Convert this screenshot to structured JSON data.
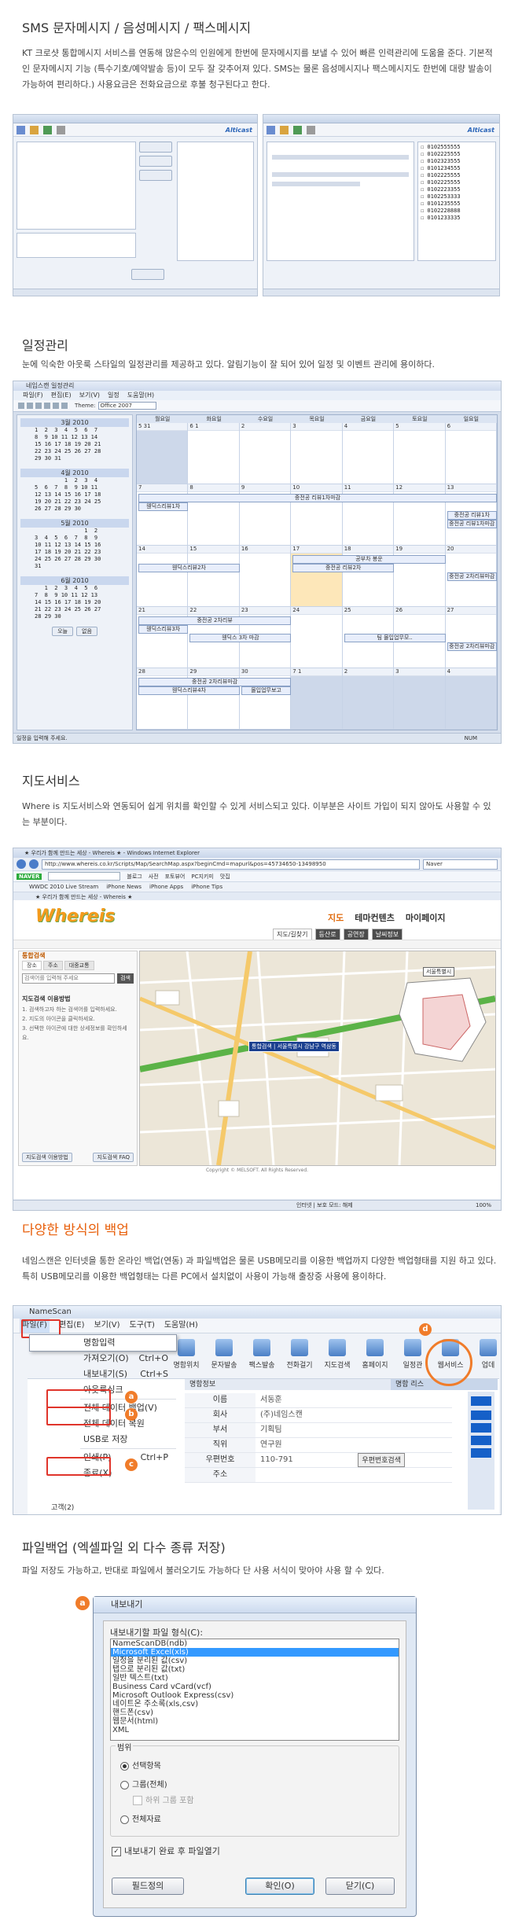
{
  "sections": {
    "sms": {
      "title": "SMS 문자메시지 / 음성메시지 / 팩스메시지",
      "desc": "KT 크로샷 통합메시지 서비스를 연동해 많은수의 인원에게 한번에 문자메시지를 보낼 수 있어 빠른 인력관리에 도움을 준다. 기본적인 문자메시지 기능 (특수기호/예약발송 등)이 모두 잘 갖추어져 있다. SMS는 물론 음성메시지나 팩스메시지도 한번에 대량 발송이 가능하여 편리하다.) 사용요금은 전화요금으로 후불 청구된다고 한다."
    },
    "schedule": {
      "title": "일정관리",
      "desc": "눈에 익숙한 아웃룩 스타일의 일정관리를 제공하고 있다. 알림기능이 잘 되어 있어 일정 및 이벤트 관리에 용이하다."
    },
    "map": {
      "title": "지도서비스",
      "desc": "Where is 지도서비스와 연동되어 쉽게 위치를 확인할 수 있게 서비스되고 있다. 이부분은 사이트 가입이 되지 않아도 사용할 수 있는 부분이다."
    },
    "backup": {
      "title": "다양한 방식의 백업",
      "desc": "네임스캔은 인터넷을 통한  온라인 백업(연동) 과 파일백업은 물론 USB메모리를 이용한 백업까지 다양한 백업형태를 지원 하고 있다. 특히 USB메모리를 이용한 백업형태는 다른 PC에서 설치없이 사용이 가능해 출장중 사용에 용이하다."
    },
    "filebackup": {
      "title": "파일백업 (엑셀파일 외 다수 종류 저장)",
      "desc": "파일 저장도 가능하고, 반대로 파일에서 불러오기도 가능하다 단 사용 서식이 맞아야 사용 할 수 있다."
    }
  },
  "sms_shots": {
    "brand": "Alticast",
    "phone_list": [
      "0102555555",
      "0102225555",
      "0102323555",
      "0101234555",
      "0102225555",
      "0102225555",
      "0102223355",
      "0102253333",
      "0101235555",
      "0102228888",
      "0101233335"
    ]
  },
  "schedule_shot": {
    "window_title": "네임스캔 일정관리",
    "menu": [
      "파일(F)",
      "편집(E)",
      "보기(V)",
      "일정",
      "도움말(H)"
    ],
    "theme_label": "Theme:",
    "theme_value": "Office 2007",
    "status_text": "일정을 입력해 주세요.",
    "status_right": "NUM",
    "weekdays": [
      "월요일",
      "화요일",
      "수요일",
      "목요일",
      "금요일",
      "토요일",
      "일요일"
    ],
    "mini_months": [
      {
        "title": "3월 2010",
        "rows": [
          "1  2  3  4  5  6  7",
          "8  9 10 11 12 13 14",
          "15 16 17 18 19 20 21",
          "22 23 24 25 26 27 28",
          "29 30 31"
        ]
      },
      {
        "title": "4월 2010",
        "rows": [
          "         1  2  3  4",
          "5  6  7  8  9 10 11",
          "12 13 14 15 16 17 18",
          "19 20 21 22 23 24 25",
          "26 27 28 29 30"
        ]
      },
      {
        "title": "5월 2010",
        "rows": [
          "               1  2",
          "3  4  5  6  7  8  9",
          "10 11 12 13 14 15 16",
          "17 18 19 20 21 22 23",
          "24 25 26 27 28 29 30",
          "31"
        ]
      },
      {
        "title": "6월 2010",
        "rows": [
          "   1  2  3  4  5  6",
          "7  8  9 10 11 12 13",
          "14 15 16 17 18 19 20",
          "21 22 23 24 25 26 27",
          "28 29 30"
        ]
      }
    ],
    "today_button": "오늘",
    "none_button": "없음",
    "weeks": [
      [
        "5 31",
        "6 1",
        "2",
        "3",
        "4",
        "5",
        "6"
      ],
      [
        "7",
        "8",
        "9",
        "10",
        "11",
        "12",
        "13"
      ],
      [
        "14",
        "15",
        "16",
        "17",
        "18",
        "19",
        "20"
      ],
      [
        "21",
        "22",
        "23",
        "24",
        "25",
        "26",
        "27"
      ],
      [
        "28",
        "29",
        "30",
        "7 1",
        "2",
        "3",
        "4"
      ]
    ],
    "events": [
      {
        "label": "중전공 리뷰1차마감"
      },
      {
        "label": "웬딕스리뷰1차"
      },
      {
        "label": "중전공 리뷰1차"
      },
      {
        "label": "중전공 리뷰1차마감"
      },
      {
        "label": "웬딕스리뷰2차"
      },
      {
        "label": "공부차 봉운"
      },
      {
        "label": "중전공 리뷰2차"
      },
      {
        "label": "중전공 2차리뷰마감"
      },
      {
        "label": "중전공 2차리뷰"
      },
      {
        "label": "웬딕스리뷰3차"
      },
      {
        "label": "웬딕스 3차 마감"
      },
      {
        "label": "팀 몰입업무모.."
      },
      {
        "label": "중전공 2차리뷰마감"
      },
      {
        "label": "중전공 2차리뷰마감"
      },
      {
        "label": "웬딕스리뷰4차"
      },
      {
        "label": "몰입업무보고"
      }
    ]
  },
  "map_shot": {
    "browser_title": "★ 우리가 함께 만드는 세상 - Whereis ★ - Windows Internet Explorer",
    "url": "http://www.whereis.co.kr/Scripts/Map/SearchMap.aspx?beginCmd=mapurl&pos=45734650-13498950",
    "search_brand": "Naver",
    "toolbar_items": [
      "블로그",
      "사전",
      "포토뷰어",
      "PC지키미",
      "맛집"
    ],
    "bookmarks": [
      "WWDC 2010 Live Stream",
      "iPhone News",
      "iPhone Apps",
      "iPhone Tips"
    ],
    "tab_title": "★ 우리가 함께 만드는 세상 - Whereis ★",
    "logo": "Whereis",
    "nav": [
      "지도",
      "테마컨텐츠",
      "마이페이지"
    ],
    "subnav": [
      "지도/길찾기",
      "등산로",
      "공연장",
      "날씨정보"
    ],
    "panel_header": "통합검색",
    "panel_tabs": [
      "장소",
      "주소",
      "대중교통"
    ],
    "search_placeholder": "검색어를 입력해 주세요",
    "search_button": "검색",
    "help_title": "지도검색 이용방법",
    "help_items": [
      "1. 검색하고자 하는 검색어를 입력하세요.",
      "2. 지도의 아이콘을 클릭하세요.",
      "3. 선택한 아이콘에 대한 상세정보를 확인하세요."
    ],
    "marker_label": "통합검색 | 서울특별시 강남구 역삼동",
    "region_select": "서울특별시",
    "copyright": "Copyright © MELSOFT. All Rights Reserved.",
    "status_zone": "인터넷 | 보호 모드: 해제",
    "zoom": "100%",
    "footer_left": "지도검색 이용방법",
    "footer_right": "지도검색 FAQ"
  },
  "backup_shot": {
    "window_title": "NameScan",
    "menu": [
      "파일(F)",
      "편집(E)",
      "보기(V)",
      "도구(T)",
      "도움말(H)"
    ],
    "file_menu": [
      "명함입력",
      "가져오기(O)",
      "내보내기(S)",
      "아웃룩싱크",
      "전체 데이터 백업(V)",
      "전체 데이터 복원",
      "USB로 저장",
      "인쇄(P)",
      "종료(X)"
    ],
    "shortcut_open": "Ctrl+O",
    "shortcut_export": "Ctrl+S",
    "shortcut_print": "Ctrl+P",
    "toolbar": [
      "명함위치",
      "문자발송",
      "팩스발송",
      "전화걸기",
      "지도검색",
      "홈페이지",
      "일정관",
      "웹서비스",
      "업데"
    ],
    "card_panel_title": "명함정보",
    "fields": [
      "이름",
      "회사",
      "부서",
      "직위",
      "우편번호",
      "주소"
    ],
    "field_values": [
      "서동훈",
      "(주)네임스캔",
      "기획팀",
      "연구원",
      "110-791",
      ""
    ],
    "postcode_button": "우편번호검색",
    "group_item": "고객(2)",
    "right_panel": "명함 리스",
    "badges": [
      "a",
      "b",
      "c",
      "d"
    ]
  },
  "export_dialog": {
    "badge": "a",
    "title": "내보내기",
    "format_label": "내보내기할 파일 형식(C):",
    "formats": [
      "NameScanDB(ndb)",
      "Microsoft Excel(xls)",
      "일정을 분리된 값(csv)",
      "탭으로 분리된 값(txt)",
      "일반 텍스트(txt)",
      "Business Card vCard(vcf)",
      "Microsoft Outlook Express(csv)",
      "네이트온 주소록(xls,csv)",
      "핸드폰(csv)",
      "웹문서(html)",
      "XML"
    ],
    "selected_format": 1,
    "range_label": "범위",
    "range_options": [
      "선택항목",
      "그룹(전체)",
      "전체자료"
    ],
    "sub_option": "하위 그룹 포함",
    "open_after": "내보내기 완료 후 파일열기",
    "buttons": [
      "필드정의",
      "확인(O)",
      "닫기(C)"
    ]
  }
}
